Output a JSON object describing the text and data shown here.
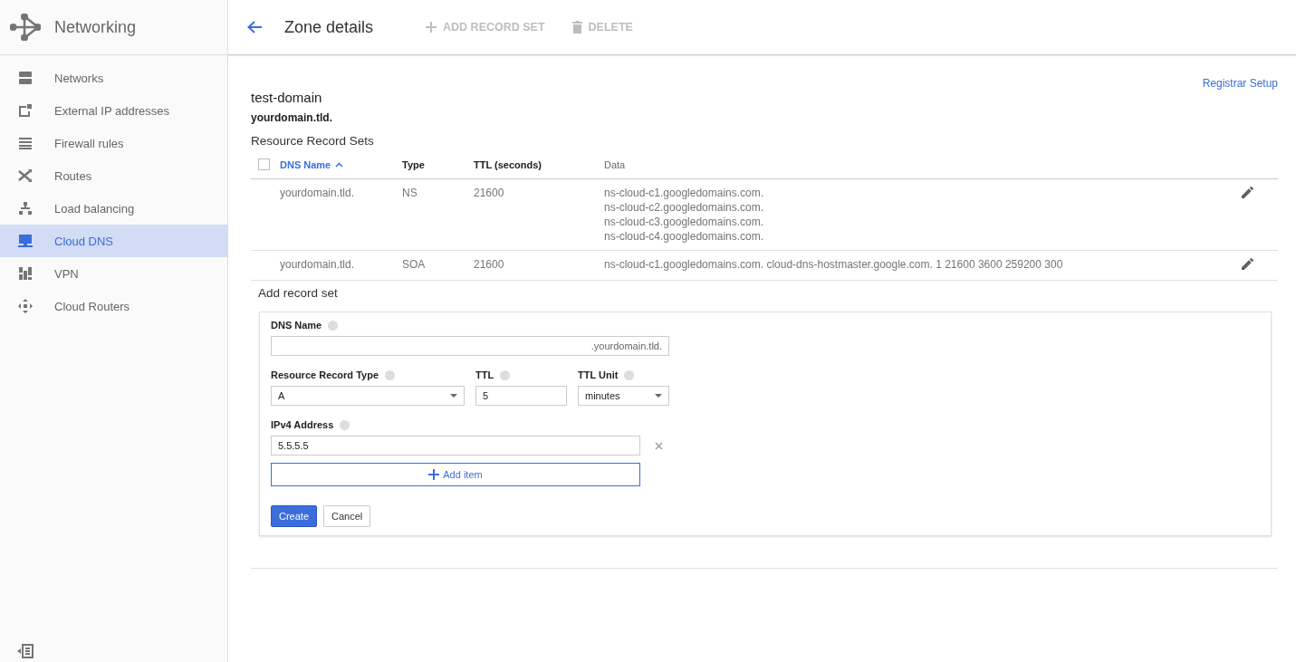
{
  "sidebar": {
    "title": "Networking",
    "items": [
      {
        "label": "Networks",
        "selected": false
      },
      {
        "label": "External IP addresses",
        "selected": false
      },
      {
        "label": "Firewall rules",
        "selected": false
      },
      {
        "label": "Routes",
        "selected": false
      },
      {
        "label": "Load balancing",
        "selected": false
      },
      {
        "label": "Cloud DNS",
        "selected": true
      },
      {
        "label": "VPN",
        "selected": false
      },
      {
        "label": "Cloud Routers",
        "selected": false
      }
    ]
  },
  "header": {
    "title": "Zone details",
    "actions": [
      {
        "label": "ADD RECORD SET",
        "disabled": true
      },
      {
        "label": "DELETE",
        "disabled": true
      }
    ]
  },
  "zone": {
    "name": "test-domain",
    "dns_name": "yourdomain.tld.",
    "link": "Registrar Setup",
    "section_title": "Resource Record Sets"
  },
  "table": {
    "select_all_checked": false,
    "columns": [
      {
        "label": "DNS Name",
        "sorted": true
      },
      {
        "label": "Type",
        "sorted": false
      },
      {
        "label": "TTL (seconds)",
        "sorted": false
      },
      {
        "label": "Data",
        "sorted": false
      }
    ],
    "rows": [
      {
        "name": "yourdomain.tld.",
        "type": "NS",
        "ttl": "21600",
        "data": [
          "ns-cloud-c1.googledomains.com.",
          "ns-cloud-c2.googledomains.com.",
          "ns-cloud-c3.googledomains.com.",
          "ns-cloud-c4.googledomains.com."
        ]
      },
      {
        "name": "yourdomain.tld.",
        "type": "SOA",
        "ttl": "21600",
        "data": [
          "ns-cloud-c1.googledomains.com. cloud-dns-hostmaster.google.com. 1 21600 3600 259200 300"
        ]
      }
    ]
  },
  "form": {
    "title": "Add record set",
    "dns_name_label": "DNS Name",
    "dns_name_suffix": ".yourdomain.tld.",
    "type_label": "Resource Record Type",
    "type_value": "A",
    "ttl_label": "TTL",
    "ttl_value": "5",
    "unit_label": "TTL Unit",
    "unit_value": "minutes",
    "address_label": "IPv4 Address",
    "addresses": [
      "5.5.5.5"
    ],
    "add_item": "Add item",
    "create": "Create",
    "cancel": "Cancel"
  }
}
